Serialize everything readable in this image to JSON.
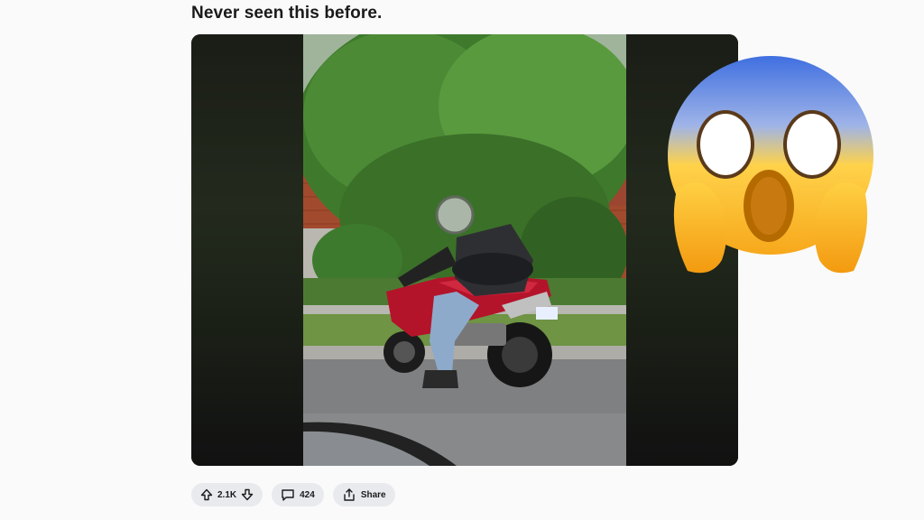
{
  "post": {
    "title": "Never seen this before."
  },
  "actions": {
    "votes": "2.1K",
    "comments": "424",
    "share_label": "Share"
  },
  "colors": {
    "background": "#fafafa",
    "pill": "#e8eaed",
    "bike_red": "#b3142a",
    "emoji_yellow": "#ffc83d",
    "emoji_blue": "#3f6fe0"
  },
  "icons": [
    "upvote-icon",
    "downvote-icon",
    "comment-icon",
    "share-icon",
    "screaming-face-emoji"
  ]
}
